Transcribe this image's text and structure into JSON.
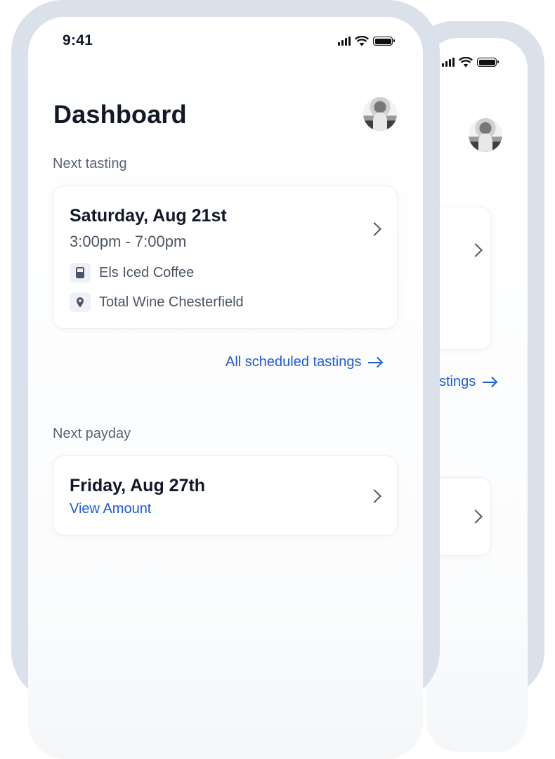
{
  "status_bar": {
    "time": "9:41"
  },
  "dashboard": {
    "title": "Dashboard",
    "next_tasting": {
      "section_label": "Next tasting",
      "date": "Saturday, Aug 21st",
      "time_range": "3:00pm - 7:00pm",
      "product": "Els Iced Coffee",
      "product_icon": "drink-icon",
      "location": "Total Wine Chesterfield",
      "location_icon": "map-pin-icon"
    },
    "all_tastings_link": "All scheduled tastings",
    "back_link_fragment": "stings",
    "next_payday": {
      "section_label": "Next payday",
      "date": "Friday, Aug 27th",
      "view_amount": "View Amount"
    }
  },
  "colors": {
    "link": "#1e5bd6",
    "phone_frame": "#dbe1ea",
    "muted_text": "#5b6472"
  }
}
